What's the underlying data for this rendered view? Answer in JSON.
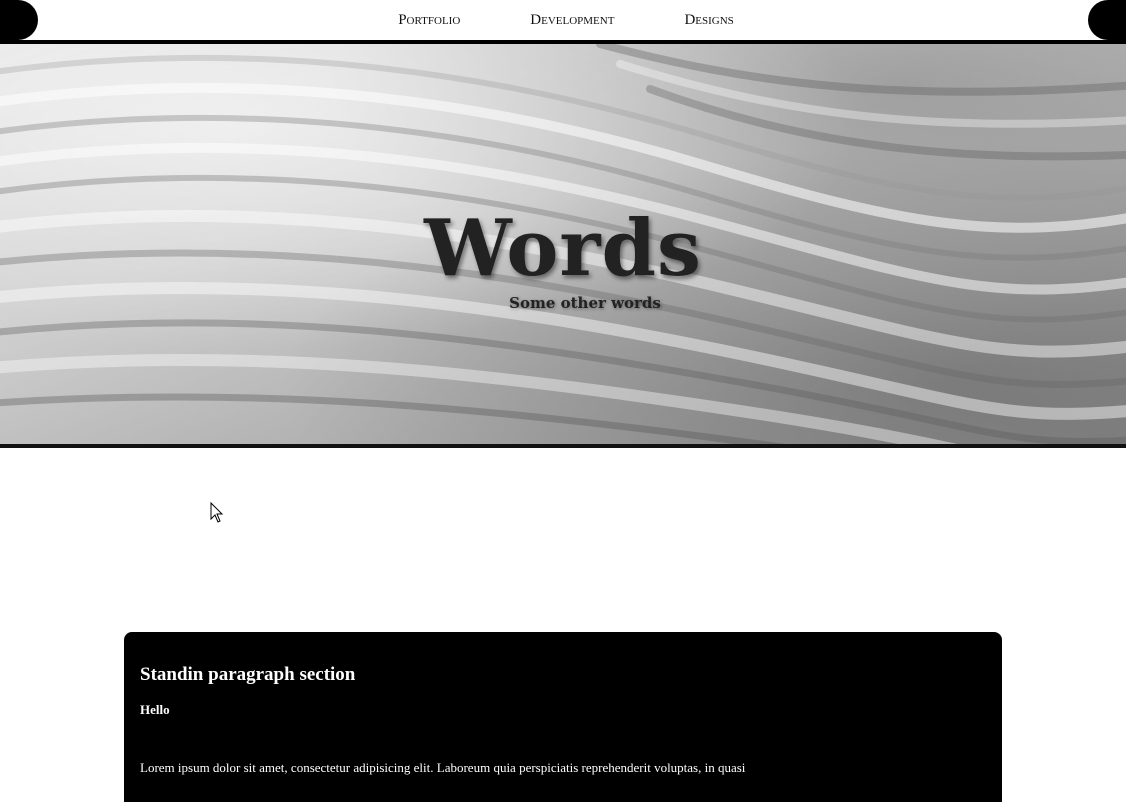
{
  "nav": {
    "items": [
      {
        "label": "Portfolio"
      },
      {
        "label": "Development"
      },
      {
        "label": "Designs"
      }
    ]
  },
  "hero": {
    "title": "Words",
    "subtitle": "Some other words"
  },
  "section": {
    "heading": "Standin paragraph section",
    "subheading": "Hello",
    "paragraph": "Lorem ipsum dolor sit amet, consectetur adipisicing elit. Laboreum quia perspiciatis reprehenderit voluptas, in quasi"
  },
  "colors": {
    "accent": "#000000",
    "text": "#222222"
  },
  "icons": {
    "cursor": "arrow-cursor-icon"
  }
}
